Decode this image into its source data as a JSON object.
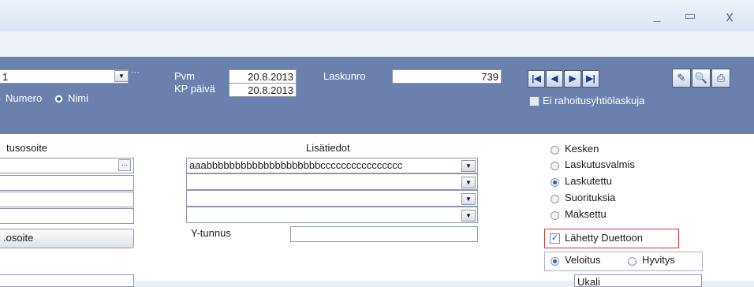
{
  "window": {
    "minimize": "_",
    "maximize": "▭",
    "close": "x"
  },
  "header": {
    "customer_value": "1",
    "search_by_number": "Numero",
    "search_by_name": "Nimi",
    "pvm_label": "Pvm",
    "pvm_value": "20.8.2013",
    "kp_label": "KP päivä",
    "kp_value": "20.8.2013",
    "laskunro_label": "Laskunro",
    "laskunro_value": "739",
    "ei_rahoitus_label": "Ei rahoitusyhtiölaskuja"
  },
  "address": {
    "label": "tusosoite",
    "button": ".osoite"
  },
  "lisatiedot": {
    "label": "Lisätiedot",
    "line1": "aaabbbbbbbbbbbbbbbbbbbbcccccccccccccccc",
    "ytunnus_label": "Y-tunnus"
  },
  "status": {
    "options": [
      "Kesken",
      "Laskutusvalmis",
      "Laskutettu",
      "Suorituksia",
      "Maksettu"
    ],
    "selected": "Laskutettu",
    "duettoon_label": "Lähetty Duettoon",
    "veloitus": "Veloitus",
    "hyvitys": "Hyvitys"
  },
  "bottom": {
    "field_value": "Ukali"
  },
  "colors": {
    "header_blue": "#6b80ad",
    "highlight_red": "#e03030",
    "radio_blue": "#1d5fd1"
  }
}
